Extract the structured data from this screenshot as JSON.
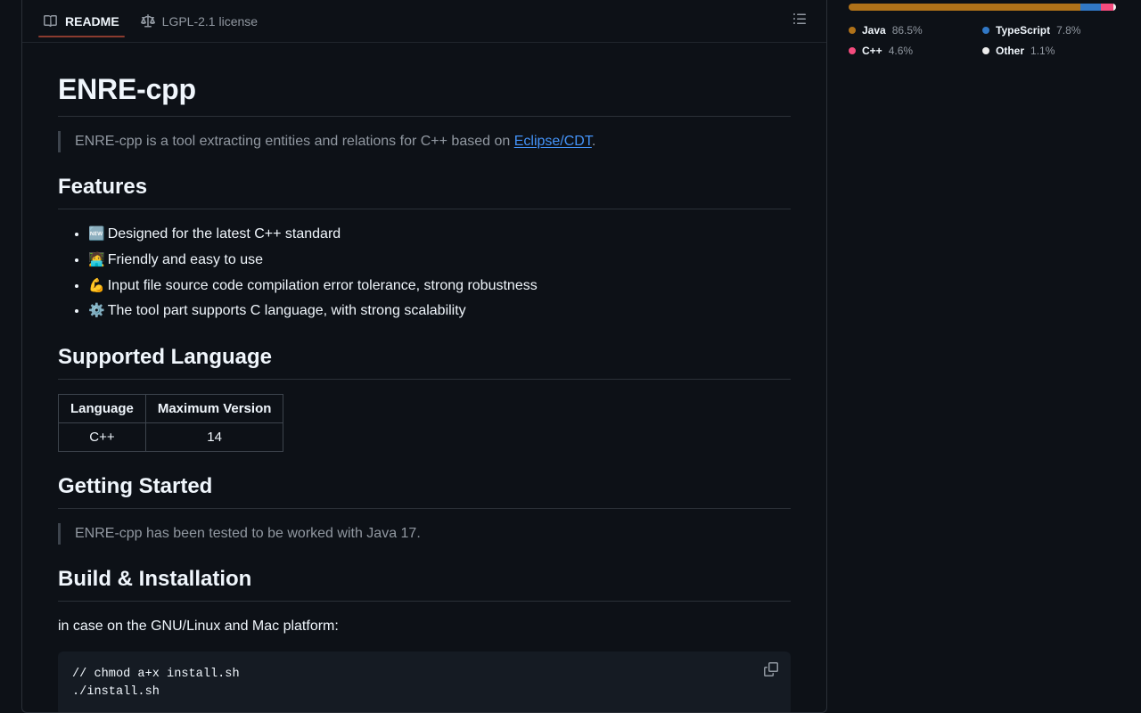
{
  "readme": {
    "tabs": [
      {
        "id": "readme",
        "label": "README",
        "icon": "book-icon",
        "active": true
      },
      {
        "id": "license",
        "label": "LGPL-2.1 license",
        "icon": "law-icon",
        "active": false
      }
    ],
    "toc_button": {
      "icon": "list-unordered-icon",
      "label": "Outline"
    },
    "title": "ENRE-cpp",
    "intro": {
      "before_link": "ENRE-cpp is a tool extracting entities and relations for C++ based on ",
      "link_text": "Eclipse/CDT",
      "after_link": "."
    },
    "features": {
      "heading": "Features",
      "items": [
        {
          "emoji": "🆕",
          "emoji_name": "new-button-emoji",
          "text": "Designed for the latest C++ standard"
        },
        {
          "emoji": "🧑‍💻",
          "emoji_name": "technologist-emoji",
          "text": "Friendly and easy to use"
        },
        {
          "emoji": "💪",
          "emoji_name": "flexed-biceps-emoji",
          "text": "Input file source code compilation error tolerance, strong robustness"
        },
        {
          "emoji": "⚙️",
          "emoji_name": "gear-emoji",
          "text": "The tool part supports C language, with strong scalability"
        }
      ]
    },
    "supported_language": {
      "heading": "Supported Language",
      "table": {
        "headers": [
          "Language",
          "Maximum Version"
        ],
        "rows": [
          [
            "C++",
            "14"
          ]
        ]
      }
    },
    "getting_started": {
      "heading": "Getting Started",
      "quote": "ENRE-cpp has been tested to be worked with Java 17."
    },
    "build_installation": {
      "heading": "Build & Installation",
      "paragraph": "in case on the GNU/Linux and Mac platform:",
      "code": "// chmod a+x install.sh\n./install.sh",
      "copy_button_icon": "copy-icon"
    }
  },
  "languages": {
    "items": [
      {
        "name": "Java",
        "percent": "86.5%",
        "value": 86.5,
        "color": "#b07219"
      },
      {
        "name": "TypeScript",
        "percent": "7.8%",
        "value": 7.8,
        "color": "#3178c6"
      },
      {
        "name": "C++",
        "percent": "4.6%",
        "value": 4.6,
        "color": "#f34b7d"
      },
      {
        "name": "Other",
        "percent": "1.1%",
        "value": 1.1,
        "color": "#ededed"
      }
    ]
  },
  "theme": {
    "background": "#0d1117",
    "panel_border": "#2a2f37",
    "text": "#f0f6fc",
    "muted": "#9198a1",
    "link": "#4493f8",
    "code_bg": "#151b23",
    "active_tab_underline": "#8b3b2f"
  }
}
